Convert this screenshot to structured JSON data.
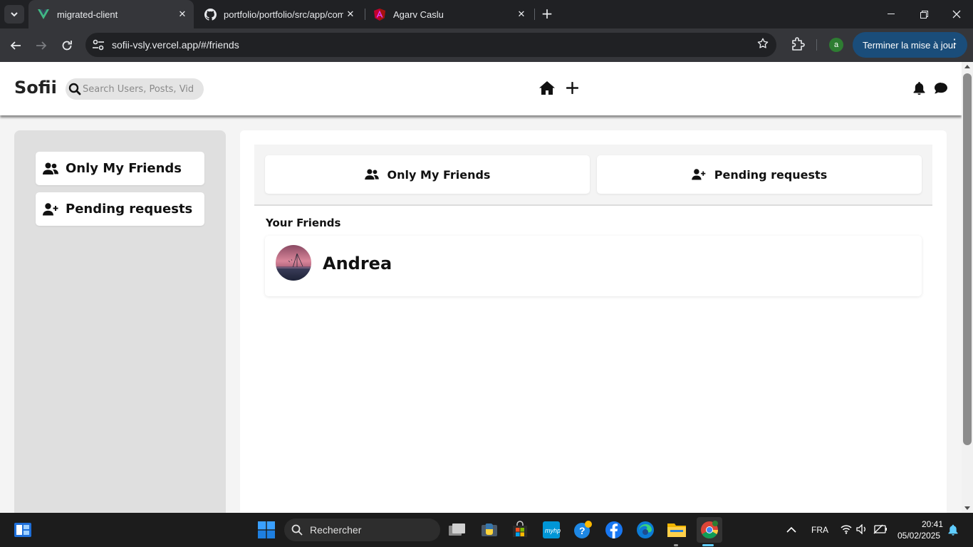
{
  "browser": {
    "tabs": [
      {
        "title": "migrated-client",
        "active": true,
        "favicon": "vue-icon"
      },
      {
        "title": "portfolio/portfolio/src/app/com",
        "active": false,
        "favicon": "github-icon"
      },
      {
        "title": "Agarv Caslu",
        "active": false,
        "favicon": "angular-icon"
      }
    ],
    "url": "sofii-vsly.vercel.app/#/friends",
    "profile_initial": "a",
    "update_label": "Terminer la mise à jour",
    "colors": {
      "chrome_dark": "#202124",
      "toolbar": "#35363a",
      "update_button": "#1a4d7a"
    }
  },
  "app": {
    "brand": "Sofii",
    "search_placeholder": "Search Users, Posts, Videos",
    "nav_icons": [
      "home-icon",
      "plus-icon",
      "bell-icon",
      "chat-icon"
    ]
  },
  "sidebar": {
    "items": [
      {
        "label": "Only My Friends",
        "icon": "user-friends-icon"
      },
      {
        "label": "Pending requests",
        "icon": "user-plus-icon"
      }
    ]
  },
  "main": {
    "tabs": [
      {
        "label": "Only My Friends",
        "icon": "user-friends-icon"
      },
      {
        "label": "Pending requests",
        "icon": "user-plus-icon"
      }
    ],
    "section_title": "Your Friends",
    "friends": [
      {
        "name": "Andrea",
        "avatar": "sunset-photo-avatar"
      }
    ]
  },
  "taskbar": {
    "search_label": "Rechercher",
    "language": "FRA",
    "time": "20:41",
    "date": "05/02/2025"
  }
}
